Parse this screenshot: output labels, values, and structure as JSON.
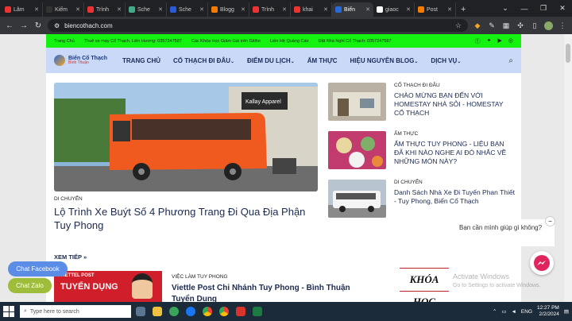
{
  "browser": {
    "tabs": [
      {
        "label": "Lâm",
        "fav": "#e33"
      },
      {
        "label": "Kiếm",
        "fav": "#333"
      },
      {
        "label": "Trình",
        "fav": "#e33"
      },
      {
        "label": "Sche",
        "fav": "#4a8"
      },
      {
        "label": "Sche",
        "fav": "#2a5bd7"
      },
      {
        "label": "Blogg",
        "fav": "#f57c00"
      },
      {
        "label": "Trình",
        "fav": "#e33"
      },
      {
        "label": "khai",
        "fav": "#e33"
      },
      {
        "label": "Biến",
        "fav": "#2a6ad6",
        "active": true
      },
      {
        "label": "giaoc",
        "fav": "#fff"
      },
      {
        "label": "Post",
        "fav": "#f57c00"
      }
    ],
    "new_tab": "+",
    "url": "biencothach.com"
  },
  "site": {
    "topbar": {
      "items": [
        "Trang Chủ",
        "Thuê xe máy Cổ Thạch, Liên Hương: 0357247587",
        "Các Khóa Học Giảm Giá trên Gitiho",
        "Liên Hệ Quảng Cáo",
        "Đặt Nhà Nghỉ Cổ Thạch: 0357247587"
      ]
    },
    "logo": {
      "line1": "Biển Cổ Thạch",
      "line2": "Bình Thuận"
    },
    "menu": [
      {
        "label": "TRANG CHỦ",
        "arrow": ""
      },
      {
        "label": "CỔ THẠCH ĐI ĐÂU",
        "arrow": "⌄"
      },
      {
        "label": "ĐIỂM DU LỊCH",
        "arrow": "⌄"
      },
      {
        "label": "ẨM THỰC",
        "arrow": ""
      },
      {
        "label": "HIỆU NGUYÊN BLOG",
        "arrow": "⌄"
      },
      {
        "label": "DỊCH VỤ",
        "arrow": "⌄"
      }
    ],
    "hero": {
      "category": "DI CHUYỂN",
      "title": "Lộ Trình Xe Buýt Số 4 Phương Trang Đi Qua Địa Phận Tuy Phong",
      "bus_text": "Kallay Apparel"
    },
    "side_posts": [
      {
        "category": "CỔ THẠCH ĐI ĐÂU",
        "title": "CHÀO MỪNG BẠN ĐẾN VỚI HOMESTAY NHÀ SỎI - HOMESTAY CỔ THẠCH"
      },
      {
        "category": "ẨM THỰC",
        "title": "ẨM THỰC TUY PHONG - LIỆU BẠN ĐÃ KHI NÀO NGHE AI ĐÓ NHẮC VỀ NHỮNG MÓN NÀY?"
      },
      {
        "category": "DI CHUYỂN",
        "title": "Danh Sách Nhà Xe Đi Tuyến Phan Thiết - Tuy Phong, Biển Cổ Thạch"
      }
    ],
    "more_label": "XEM TIẾP »",
    "bottom_post": {
      "category": "VIỆC LÀM TUY PHONG",
      "title": "Viettle Post Chi Nhánh Tuy Phong - Bình Thuận Tuyển Dụng",
      "thumb_line1": "VIETTEL POST",
      "thumb_line2": "TUYỂN DỤNG"
    },
    "khoahoc": "KHÓA HỌC"
  },
  "widgets": {
    "chat_facebook": "Chat Facebook",
    "chat_zalo": "Chat Zalo",
    "bubble_text": "Bạn cần mình giúp gì không?",
    "bubble_close": "−",
    "watermark_line1": "Activate Windows",
    "watermark_line2": "Go to Settings to activate Windows."
  },
  "taskbar": {
    "search_placeholder": "Type here to search",
    "lang": "ENG",
    "time": "12:27 PM",
    "date": "2/2/2024"
  },
  "colors": {
    "green_strip": "#16f210",
    "nav_bg": "#c9d9f7",
    "chat_facebook": "#5b8de6",
    "chat_zalo": "#9ebd3a",
    "messenger": "#e0245e"
  }
}
